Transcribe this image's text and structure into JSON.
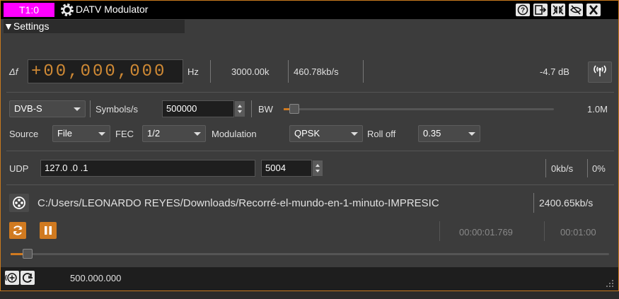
{
  "titlebar": {
    "tag": "T1:0",
    "title": "DATV Modulator",
    "buttons": [
      "help-icon",
      "move-to-workspace-icon",
      "shrink-icon",
      "hide-icon",
      "close-icon"
    ]
  },
  "settings_label": "▼Settings",
  "freq": {
    "delta_label": "Δf",
    "digits": "+00,000,000",
    "unit": "Hz",
    "sample_rate": "3000.00k",
    "bitrate": "460.78kb/s",
    "level": "-4.7 dB"
  },
  "standard": {
    "value": "DVB-S",
    "symbols_label": "Symbols/s",
    "symbols_value": "500000",
    "bw_label": "BW",
    "bw_value": "1.0M",
    "bw_fraction": 0.02
  },
  "source": {
    "label": "Source",
    "value": "File",
    "fec_label": "FEC",
    "fec_value": "1/2",
    "mod_label": "Modulation",
    "mod_value": "QPSK",
    "rolloff_label": "Roll off",
    "rolloff_value": "0.35"
  },
  "udp": {
    "label": "UDP",
    "address": "127.0 .0 .1",
    "port": "5004",
    "rate": "0kb/s",
    "percent": "0%"
  },
  "file": {
    "path": "C:/Users/LEONARDO REYES/Downloads/Recorré-el-mundo-en-1-minuto-IMPRESIC",
    "rate": "2400.65kb/s"
  },
  "playback": {
    "elapsed": "00:00:01.769",
    "total": "00:01:00",
    "progress": 0.02
  },
  "bottombar": {
    "frequency": "500.000.000"
  },
  "colors": {
    "accent": "#d07a20",
    "tag": "#ff00ff",
    "digits": "#d08a35"
  }
}
